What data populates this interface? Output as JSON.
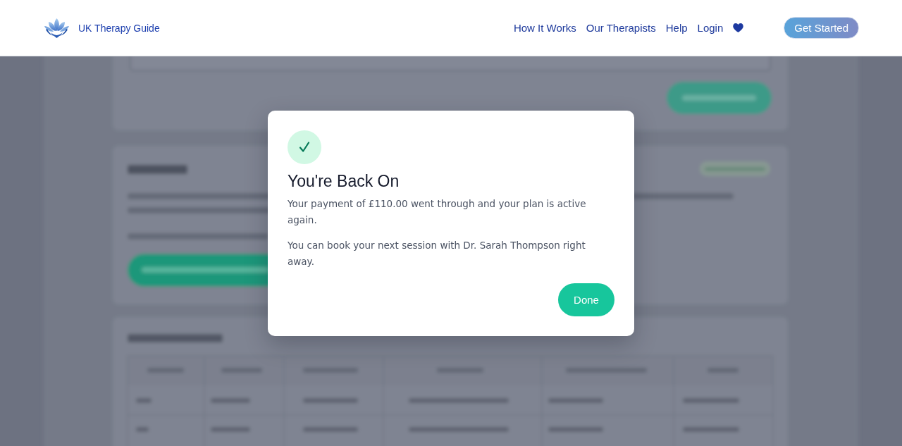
{
  "header": {
    "brand": "UK Therapy Guide",
    "nav": [
      "How It Works",
      "Our Therapists",
      "Help",
      "Login"
    ],
    "cta": "Get Started"
  },
  "modal": {
    "title": "You're Back On",
    "paragraphs": [
      "Your payment of £110.00 went through and your plan is active again.",
      "You can book your next session with Dr. Sarah Thompson right away."
    ],
    "button": "Done"
  }
}
